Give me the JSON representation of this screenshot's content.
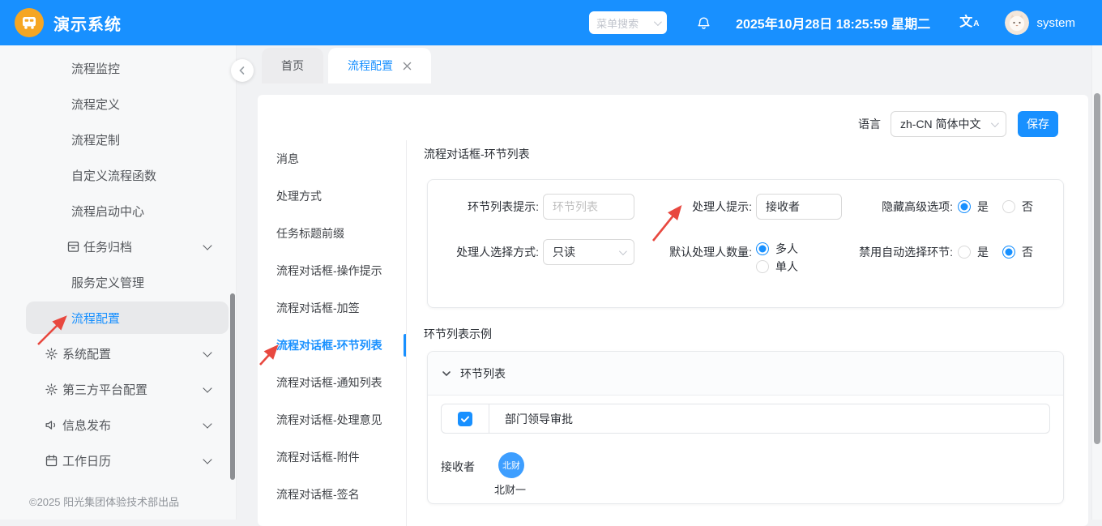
{
  "header": {
    "app_title": "演示系统",
    "search": {
      "placeholder": "菜单搜索"
    },
    "datetime": "2025年10月28日 18:25:59 星期二",
    "username": "system",
    "translate_icon": {
      "main": "文",
      "sub": "A"
    }
  },
  "sidebar": {
    "items": [
      {
        "label": "流程监控"
      },
      {
        "label": "流程定义"
      },
      {
        "label": "流程定制"
      },
      {
        "label": "自定义流程函数"
      },
      {
        "label": "流程启动中心"
      },
      {
        "label": "任务归档",
        "icon": "archive-icon",
        "expandable": true
      },
      {
        "label": "服务定义管理"
      },
      {
        "label": "流程配置",
        "active": true
      },
      {
        "label": "系统配置",
        "icon": "gear-icon",
        "expandable": true
      },
      {
        "label": "第三方平台配置",
        "icon": "gear-icon",
        "expandable": true
      },
      {
        "label": "信息发布",
        "icon": "speaker-icon",
        "expandable": true
      },
      {
        "label": "工作日历",
        "icon": "calendar-icon",
        "expandable": true
      }
    ],
    "footer": "©2025 阳光集团体验技术部出品"
  },
  "tabs": [
    {
      "label": "首页",
      "active": false
    },
    {
      "label": "流程配置",
      "active": true,
      "closable": true
    }
  ],
  "toolbar": {
    "language_label": "语言",
    "language_value": "zh-CN 简体中文",
    "save_label": "保存"
  },
  "submenu": [
    {
      "label": "消息"
    },
    {
      "label": "处理方式"
    },
    {
      "label": "任务标题前缀"
    },
    {
      "label": "流程对话框-操作提示"
    },
    {
      "label": "流程对话框-加签"
    },
    {
      "label": "流程对话框-环节列表",
      "active": true
    },
    {
      "label": "流程对话框-通知列表"
    },
    {
      "label": "流程对话框-处理意见"
    },
    {
      "label": "流程对话框-附件"
    },
    {
      "label": "流程对话框-签名"
    }
  ],
  "content": {
    "section_title": "流程对话框-环节列表",
    "form": {
      "node_list_hint": {
        "label": "环节列表提示:",
        "placeholder": "环节列表"
      },
      "handler_hint": {
        "label": "处理人提示:",
        "value": "接收者"
      },
      "hide_advanced": {
        "label": "隐藏高级选项:",
        "yes": "是",
        "no": "否",
        "selected": "是"
      },
      "handler_select_mode": {
        "label": "处理人选择方式:",
        "value": "只读"
      },
      "default_handler_count": {
        "label": "默认处理人数量:",
        "multi": "多人",
        "single": "单人",
        "selected": "多人"
      },
      "disable_auto_select": {
        "label": "禁用自动选择环节:",
        "yes": "是",
        "no": "否",
        "selected": "否"
      }
    },
    "example": {
      "section_title": "环节列表示例",
      "panel_title": "环节列表",
      "task": {
        "checked": true,
        "label": "部门领导审批"
      },
      "receiver": {
        "label": "接收者",
        "avatar_text": "北财",
        "name": "北财一"
      }
    }
  },
  "icons": {
    "logo": "car-icon",
    "notification": "bell-icon",
    "language_switch": "translate-icon",
    "user": "cat-avatar",
    "tab_close": "close-icon",
    "panel_collapse": "chevron-left-icon",
    "dropdowns": "chevron-down-icon",
    "annotations": "red-arrow"
  },
  "colors": {
    "primary": "#1890ff",
    "header_bg": "#1890ff",
    "logo_badge": "#f5a623",
    "avatar_chip": "#3d9eff",
    "annotation_arrow": "#e8483f",
    "sidebar_active_bg": "#e8e9eb"
  }
}
